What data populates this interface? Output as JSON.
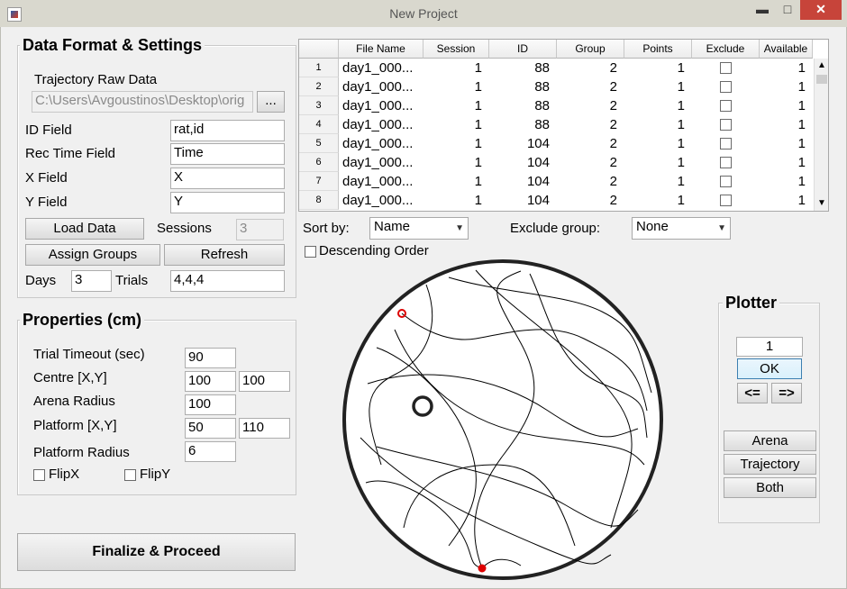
{
  "window": {
    "title": "New Project",
    "minimize": "▬",
    "maximize": "□",
    "close": "✕"
  },
  "data_format": {
    "title": "Data Format & Settings",
    "trajectory_raw_data_label": "Trajectory Raw Data",
    "path_value": "C:\\Users\\Avgoustinos\\Desktop\\orig",
    "browse_label": "...",
    "id_field_label": "ID Field",
    "id_field_value": "rat,id",
    "rec_time_label": "Rec Time Field",
    "rec_time_value": "Time",
    "x_field_label": "X Field",
    "x_field_value": "X",
    "y_field_label": "Y Field",
    "y_field_value": "Y",
    "load_data_label": "Load Data",
    "sessions_label": "Sessions",
    "sessions_value": "3",
    "assign_groups_label": "Assign Groups",
    "refresh_label": "Refresh",
    "days_label": "Days",
    "days_value": "3",
    "trials_label": "Trials",
    "trials_value": "4,4,4"
  },
  "properties": {
    "title": "Properties (cm)",
    "trial_timeout_label": "Trial Timeout (sec)",
    "trial_timeout_value": "90",
    "centre_label": "Centre [X,Y]",
    "centre_x": "100",
    "centre_y": "100",
    "arena_radius_label": "Arena Radius",
    "arena_radius_value": "100",
    "platform_label": "Platform [X,Y]",
    "platform_x": "50",
    "platform_y": "110",
    "platform_radius_label": "Platform Radius",
    "platform_radius_value": "6",
    "flipx_label": "FlipX",
    "flipy_label": "FlipY"
  },
  "finalize_label": "Finalize & Proceed",
  "table": {
    "columns": [
      "File Name",
      "Session",
      "ID",
      "Group",
      "Points",
      "Exclude",
      "Available"
    ],
    "rows": [
      {
        "n": "1",
        "file": "day1_000...",
        "session": "1",
        "id": "88",
        "group": "2",
        "points": "1",
        "available": "1"
      },
      {
        "n": "2",
        "file": "day1_000...",
        "session": "1",
        "id": "88",
        "group": "2",
        "points": "1",
        "available": "1"
      },
      {
        "n": "3",
        "file": "day1_000...",
        "session": "1",
        "id": "88",
        "group": "2",
        "points": "1",
        "available": "1"
      },
      {
        "n": "4",
        "file": "day1_000...",
        "session": "1",
        "id": "88",
        "group": "2",
        "points": "1",
        "available": "1"
      },
      {
        "n": "5",
        "file": "day1_000...",
        "session": "1",
        "id": "104",
        "group": "2",
        "points": "1",
        "available": "1"
      },
      {
        "n": "6",
        "file": "day1_000...",
        "session": "1",
        "id": "104",
        "group": "2",
        "points": "1",
        "available": "1"
      },
      {
        "n": "7",
        "file": "day1_000...",
        "session": "1",
        "id": "104",
        "group": "2",
        "points": "1",
        "available": "1"
      },
      {
        "n": "8",
        "file": "day1_000...",
        "session": "1",
        "id": "104",
        "group": "2",
        "points": "1",
        "available": "1"
      }
    ]
  },
  "sort": {
    "label": "Sort by:",
    "value": "Name",
    "descending_label": "Descending Order"
  },
  "exclude_group": {
    "label": "Exclude group:",
    "value": "None"
  },
  "plotter": {
    "title": "Plotter",
    "index_value": "1",
    "ok_label": "OK",
    "prev_label": "<=",
    "next_label": "=>",
    "arena_label": "Arena",
    "trajectory_label": "Trajectory",
    "both_label": "Both"
  },
  "colors": {
    "start_marker": "#dd0000",
    "trajectory": "#000000"
  },
  "icons": {
    "app": "matlab-icon",
    "up": "scroll-up-icon",
    "down": "scroll-down-icon"
  }
}
